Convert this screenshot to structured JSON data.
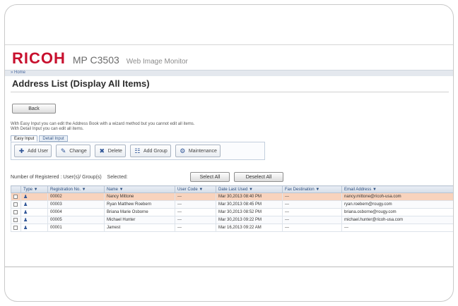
{
  "brand": {
    "logo": "RICOH",
    "model": "MP C3503",
    "product": "Web Image Monitor"
  },
  "breadcrumb": "» Home",
  "page": {
    "title": "Address List (Display All Items)"
  },
  "buttons": {
    "back": "Back",
    "select_all": "Select All",
    "deselect_all": "Deselect All"
  },
  "info": {
    "line1": "With Easy Input you can edit the Address Book with a wizard method but you cannot edit all items.",
    "line2": "With Detail Input you can edit all items."
  },
  "tabs": [
    {
      "label": "Easy Input",
      "active": true
    },
    {
      "label": "Detail Input",
      "active": false
    }
  ],
  "toolbar": [
    {
      "label": "Add User",
      "icon": "add-user-icon",
      "glyph": "✚"
    },
    {
      "label": "Change",
      "icon": "edit-pencil-icon",
      "glyph": "✎"
    },
    {
      "label": "Delete",
      "icon": "delete-icon",
      "glyph": "✖"
    },
    {
      "label": "Add Group",
      "icon": "add-group-icon",
      "glyph": "☷"
    },
    {
      "label": "Maintenance",
      "icon": "maintenance-icon",
      "glyph": "⚙"
    }
  ],
  "registered": {
    "label": "Number of Registered : User(s)/ Group(s)",
    "selected_label": "Selected:"
  },
  "table": {
    "columns": [
      "Type ▼",
      "Registration No. ▼",
      "Name ▼",
      "User Code ▼",
      "Date Last Used ▼",
      "Fax Destination ▼",
      "Email Address ▼"
    ],
    "rows": [
      {
        "reg": "00002",
        "name": "Nancy Mittone",
        "code": "---",
        "date": "Mar 30,2013 08:40 PM",
        "fax": "---",
        "email": "nancy.mittone@ricoh-usa.com",
        "selected": true
      },
      {
        "reg": "00003",
        "name": "Ryan Matthew Roebern",
        "code": "---",
        "date": "Mar 30,2013 08:45 PM",
        "fax": "---",
        "email": "ryan.roebern@rougy.com",
        "selected": false
      },
      {
        "reg": "00004",
        "name": "Briana Marie Osborne",
        "code": "---",
        "date": "Mar 30,2013 08:52 PM",
        "fax": "---",
        "email": "briana.osborne@rougy.com",
        "selected": false
      },
      {
        "reg": "00005",
        "name": "Michael Hunter",
        "code": "---",
        "date": "Mar 30,2013 09:22 PM",
        "fax": "---",
        "email": "michael.hunter@ricoh-usa.com",
        "selected": false
      },
      {
        "reg": "00001",
        "name": "Jamest",
        "code": "---",
        "date": "Mar 16,2013 09:22 AM",
        "fax": "---",
        "email": "---",
        "selected": false
      }
    ]
  }
}
